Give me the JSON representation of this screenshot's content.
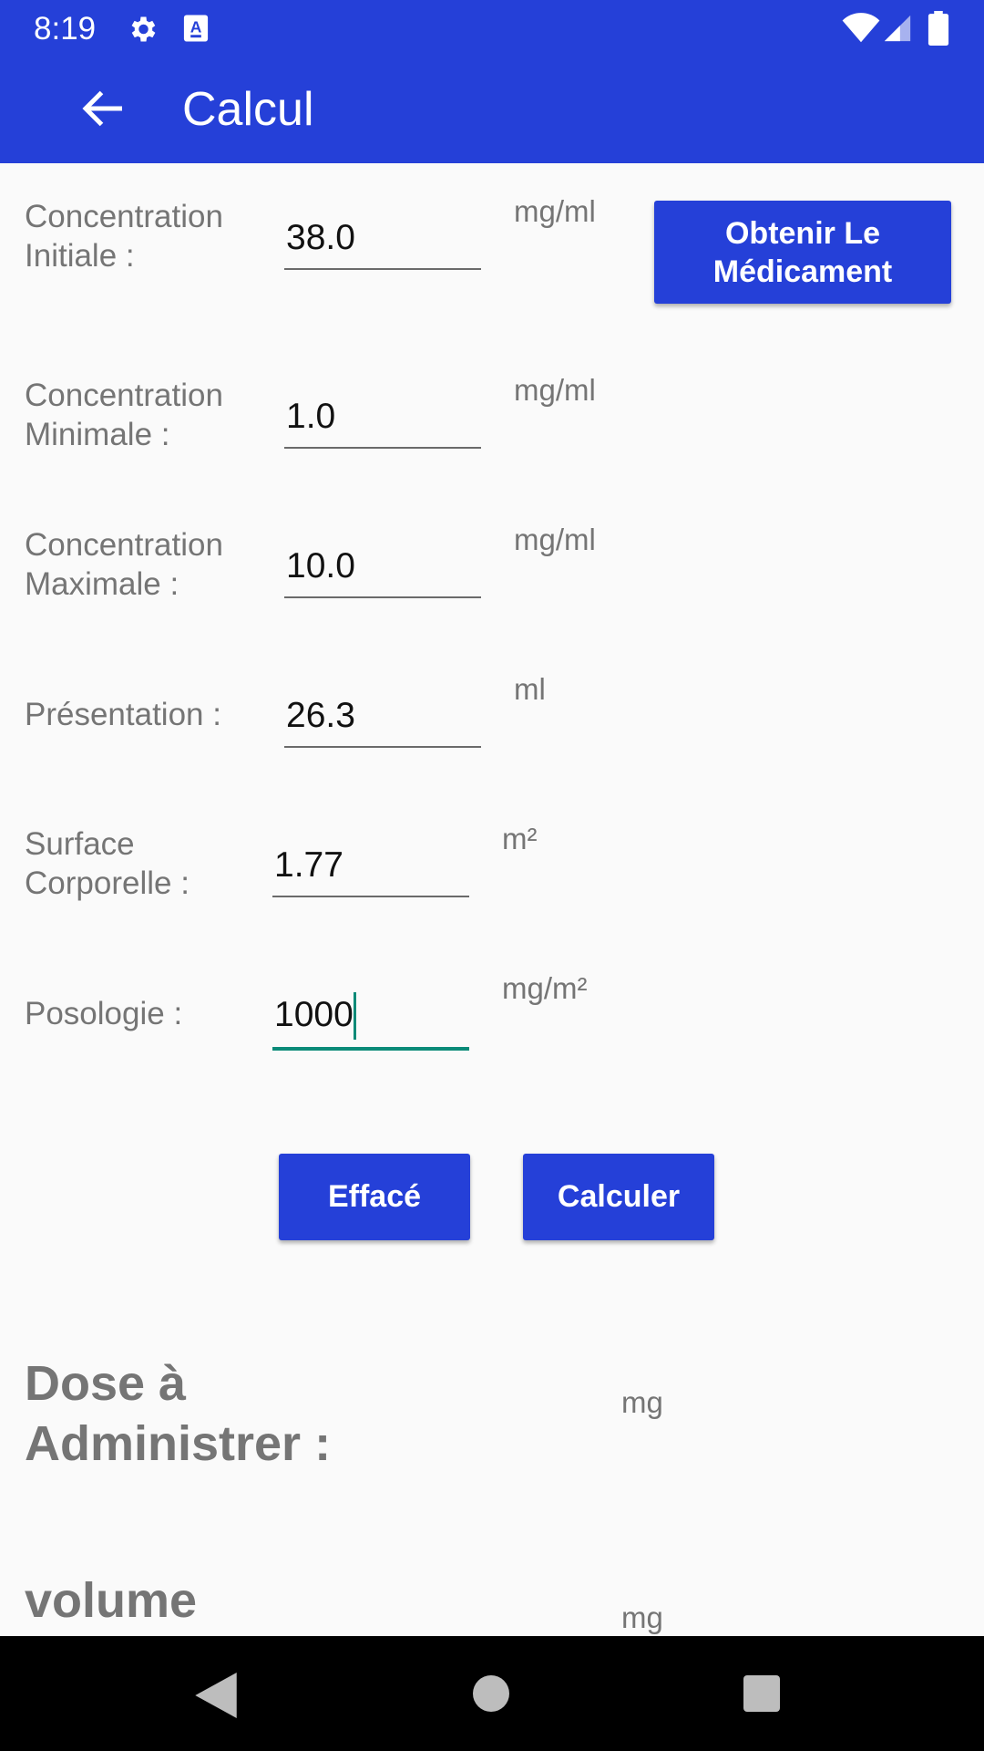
{
  "status_bar": {
    "time": "8:19",
    "icons": [
      "gear-icon",
      "text-a-icon",
      "wifi-icon",
      "signal-icon",
      "battery-icon"
    ]
  },
  "app_bar": {
    "title": "Calcul",
    "back_icon": "arrow-back-icon",
    "color": "#2540d8"
  },
  "form": {
    "initial": {
      "label": "Concentration Initiale :",
      "value": "38.0",
      "unit": "mg/ml"
    },
    "minimale": {
      "label": "Concentration Minimale :",
      "value": "1.0",
      "unit": "mg/ml"
    },
    "maximale": {
      "label": "Concentration Maximale :",
      "value": "10.0",
      "unit": "mg/ml"
    },
    "presentation": {
      "label": "Présentation :",
      "value": "26.3",
      "unit": "ml"
    },
    "surface": {
      "label": "Surface Corporelle :",
      "value": "1.77",
      "unit": "m²"
    },
    "posologie": {
      "label": "Posologie :",
      "value": "1000",
      "unit": "mg/m²"
    }
  },
  "buttons": {
    "obtenir": "Obtenir Le Médicament",
    "efface": "Effacé",
    "calculer": "Calculer"
  },
  "results": {
    "dose": {
      "label": "Dose à Administrer :",
      "unit": "mg"
    },
    "volume": {
      "label": "volume",
      "unit": "mg"
    }
  },
  "colors": {
    "primary": "#2540d8",
    "focus_underline": "#0a8a78",
    "label_gray": "#757575"
  }
}
